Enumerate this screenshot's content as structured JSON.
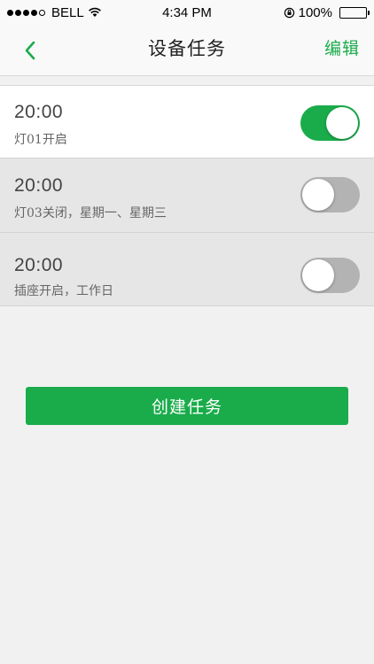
{
  "status_bar": {
    "carrier": "BELL",
    "time": "4:34 PM",
    "battery_percent": "100%",
    "signal_icon": "signal-dots-icon",
    "wifi_icon": "wifi-icon",
    "orientation_lock_icon": "orientation-lock-icon",
    "battery_icon": "battery-icon"
  },
  "nav": {
    "title": "设备任务",
    "edit_label": "编辑",
    "back_icon": "chevron-left-icon"
  },
  "tasks": [
    {
      "time": "20:00",
      "description": "灯01开启",
      "enabled": true
    },
    {
      "time": "20:00",
      "description": "灯03关闭，星期一、星期三",
      "enabled": false
    },
    {
      "time": "20:00",
      "description": "插座开启，工作日",
      "enabled": false
    }
  ],
  "create_button_label": "创建任务",
  "colors": {
    "accent": "#1aac4b",
    "background": "#f1f1f1",
    "row_enabled": "#ffffff",
    "row_disabled": "#e6e6e6",
    "toggle_off": "#b3b3b3"
  }
}
